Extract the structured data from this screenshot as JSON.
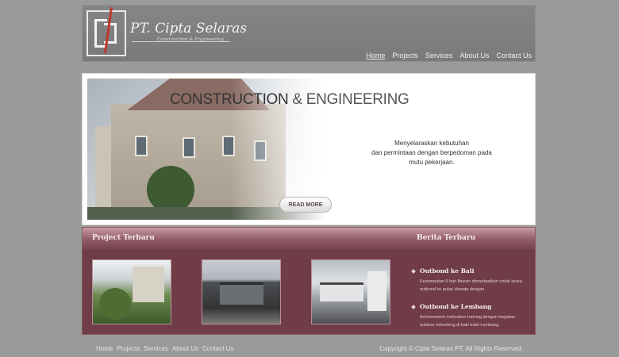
{
  "header": {
    "brand": "PT. Cipta Selaras",
    "tagline": "Construction & Engineering",
    "nav": [
      "Home",
      "Projects",
      "Services",
      "About Us",
      "Contact Us"
    ]
  },
  "banner": {
    "title_main": "CONSTRUCTION",
    "title_amp": " & ENGINEERING",
    "text_lines": [
      "Menyelaraskan kebutuhan",
      "dan permintaan dengan berpedoman pada",
      "mutu pekerjaan."
    ],
    "read_more": "READ MORE"
  },
  "content": {
    "projects_heading": "Project Terbaru",
    "news_heading": "Berita Terbaru",
    "news": [
      {
        "title": "Outbond ke Bali",
        "desc": "Kesempatan 5 hari liburan dimanfaatkan untuk acara outbond ke pulau dewata dengan."
      },
      {
        "title": "Outbond ke Lembang",
        "desc": "Achievement motivation training dengan kegiatan outdoor refreshing di kaki bukit Lembang."
      }
    ]
  },
  "footer": {
    "nav": [
      "Home",
      "Projects",
      "Services",
      "About Us",
      "Contact Us"
    ],
    "copyright": "Copyright © Cipta Selaras PT. All Rights Reserved."
  }
}
